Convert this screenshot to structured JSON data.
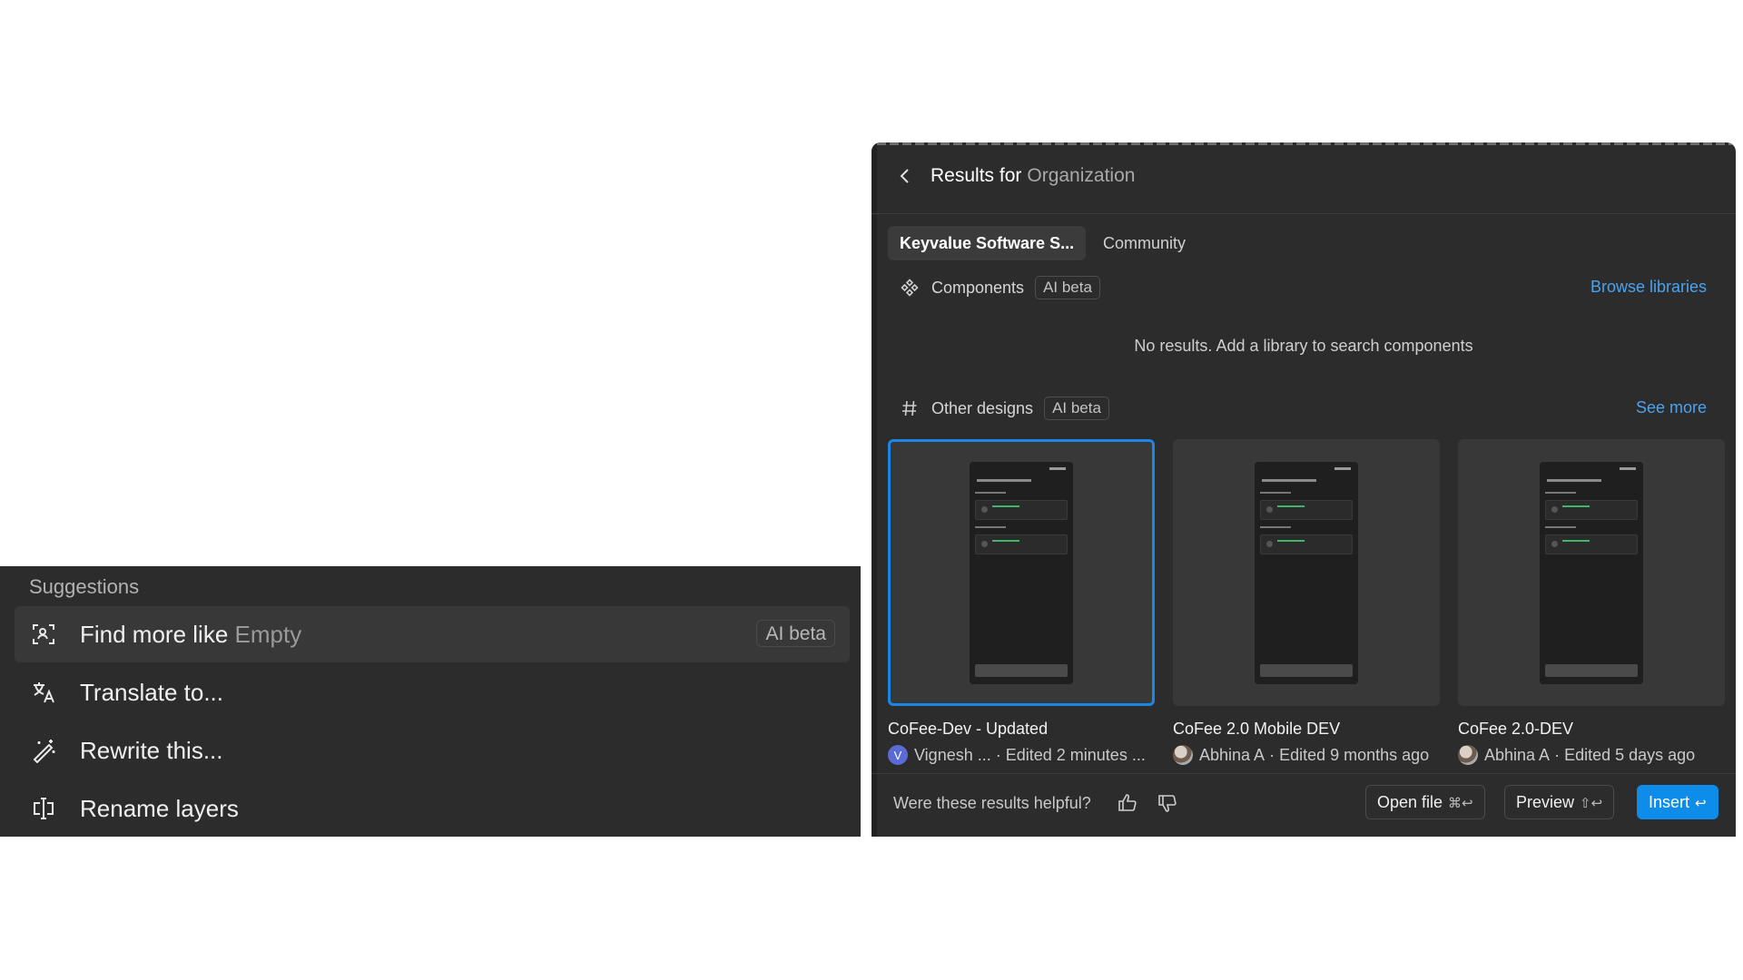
{
  "suggestions": {
    "title": "Suggestions",
    "items": [
      {
        "label": "Find more like",
        "label_suffix": "Empty",
        "badge": "AI beta",
        "icon": "find-similar-icon"
      },
      {
        "label": "Translate to...",
        "icon": "translate-icon"
      },
      {
        "label": "Rewrite this...",
        "icon": "magic-wand-icon"
      },
      {
        "label": "Rename layers",
        "icon": "rename-icon"
      }
    ]
  },
  "results": {
    "title": "Results for",
    "title_query": "Organization",
    "tabs": [
      {
        "label": "Keyvalue Software S...",
        "active": true
      },
      {
        "label": "Community",
        "active": false
      }
    ],
    "components": {
      "label": "Components",
      "badge": "AI beta",
      "link": "Browse libraries",
      "empty_message": "No results. Add a library to search components"
    },
    "other_designs": {
      "label": "Other designs",
      "badge": "AI beta",
      "link": "See more",
      "files": [
        {
          "name": "CoFee-Dev - Updated",
          "author": "Vignesh ...",
          "edited": "· Edited 2 minutes ...",
          "avatar_initial": "V",
          "selected": true
        },
        {
          "name": "CoFee 2.0 Mobile DEV",
          "author": "Abhina A",
          "edited": "· Edited 9 months ago",
          "avatar_initial": "",
          "selected": false
        },
        {
          "name": "CoFee 2.0-DEV",
          "author": "Abhina A",
          "edited": "· Edited 5 days ago",
          "avatar_initial": "",
          "selected": false
        }
      ]
    },
    "footer": {
      "question": "Were these results helpful?",
      "open_file": {
        "label": "Open file",
        "shortcut": "⌘↩"
      },
      "preview": {
        "label": "Preview",
        "shortcut": "⇧↩"
      },
      "insert": {
        "label": "Insert",
        "shortcut": "↩"
      }
    }
  },
  "colors": {
    "panel_bg": "#2c2c2c",
    "accent_blue": "#0d8ce9",
    "link_blue": "#4aa3ef"
  }
}
